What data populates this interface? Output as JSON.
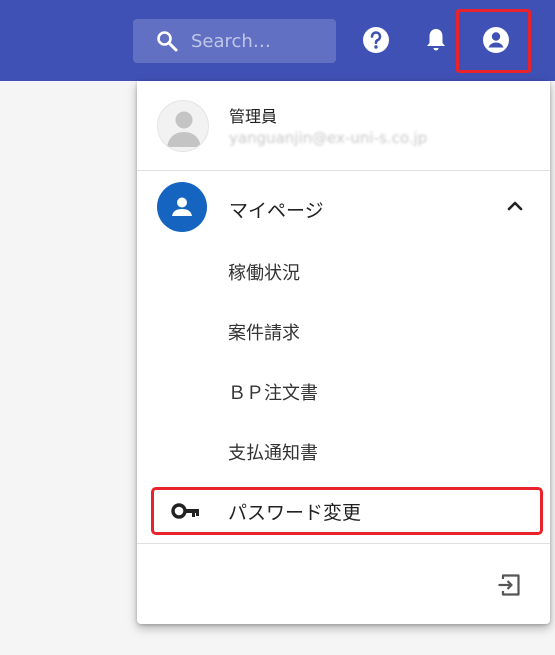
{
  "header": {
    "search_placeholder": "Search…",
    "accent": "#3f51b5",
    "icons": [
      "search-icon",
      "help-icon",
      "bell-icon",
      "account-circle-icon"
    ]
  },
  "menu": {
    "user": {
      "name": "管理員",
      "email": "yanguanjin@ex-uni-s.co.jp"
    },
    "mypage_label": "マイページ",
    "items": [
      {
        "label": "稼働状況"
      },
      {
        "label": "案件請求"
      },
      {
        "label": "ＢＰ注文書"
      },
      {
        "label": "支払通知書"
      }
    ],
    "password_label": "パスワード変更",
    "highlight_color": "#e8232b"
  }
}
